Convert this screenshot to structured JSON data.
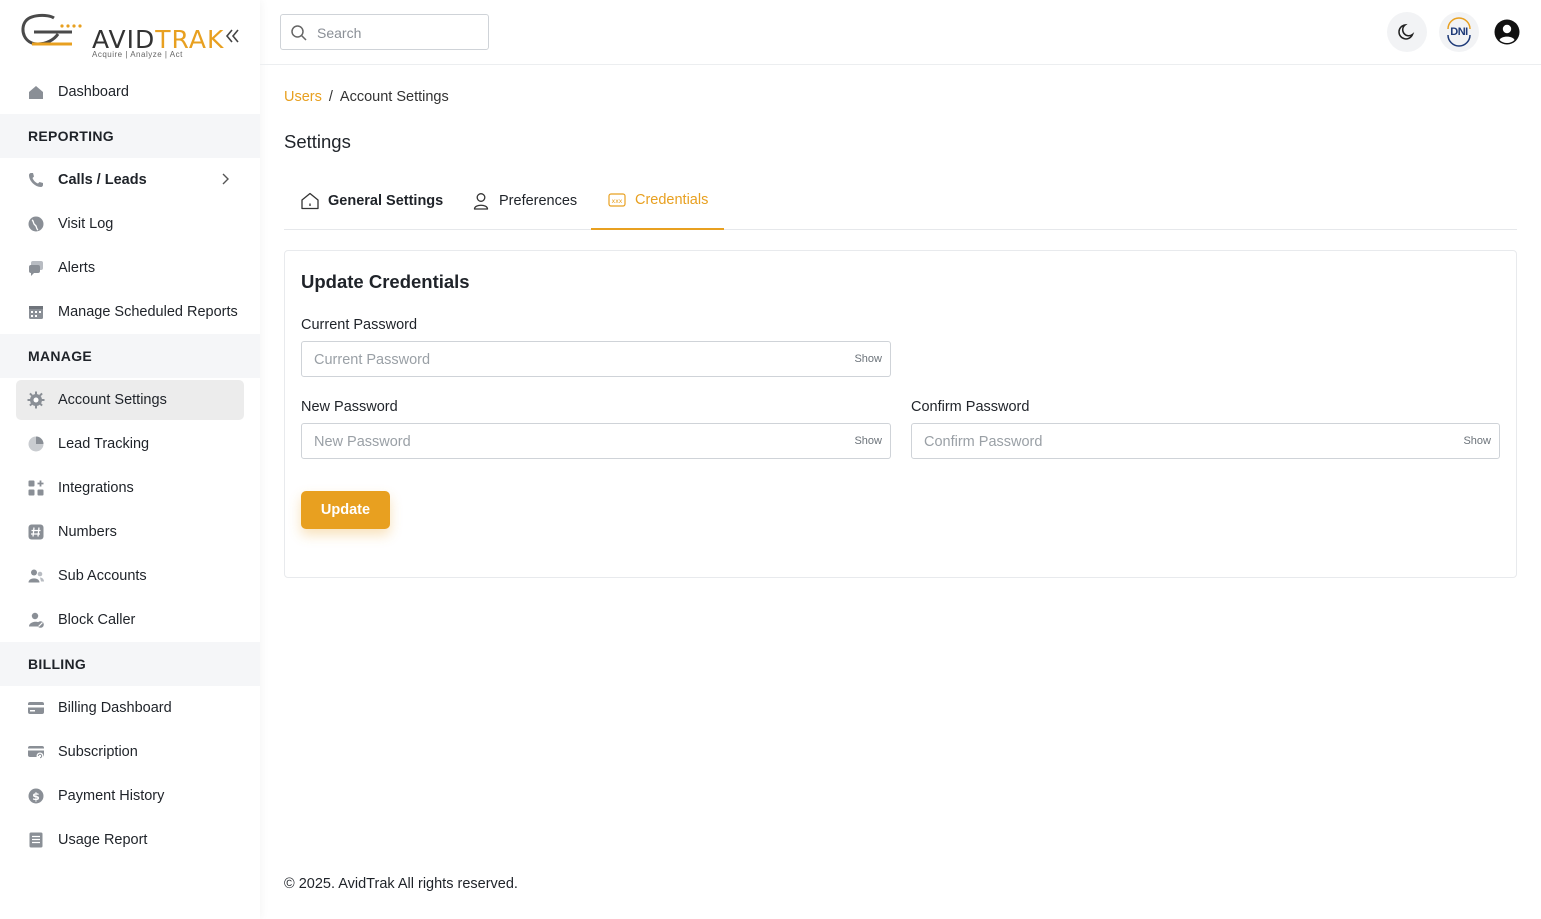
{
  "brand": {
    "name_part1": "AVID",
    "name_part2": "TRAK",
    "tagline": "Acquire  |  Analyze  |  Act",
    "accent_color": "#e8a020"
  },
  "sidebar": {
    "items": [
      {
        "type": "item",
        "label": "Dashboard",
        "icon": "home-icon"
      },
      {
        "type": "section",
        "label": "REPORTING"
      },
      {
        "type": "item",
        "label": "Calls / Leads",
        "icon": "phone-icon",
        "bold": true,
        "chevron": true
      },
      {
        "type": "item",
        "label": "Visit Log",
        "icon": "globe-icon"
      },
      {
        "type": "item",
        "label": "Alerts",
        "icon": "chat-bubbles-icon"
      },
      {
        "type": "item",
        "label": "Manage Scheduled Reports",
        "icon": "calendar-icon"
      },
      {
        "type": "section",
        "label": "MANAGE"
      },
      {
        "type": "item",
        "label": "Account Settings",
        "icon": "gear-icon",
        "active": true
      },
      {
        "type": "item",
        "label": "Lead Tracking",
        "icon": "pie-chart-icon"
      },
      {
        "type": "item",
        "label": "Integrations",
        "icon": "apps-plus-icon"
      },
      {
        "type": "item",
        "label": "Numbers",
        "icon": "hashtag-icon"
      },
      {
        "type": "item",
        "label": "Sub Accounts",
        "icon": "users-icon"
      },
      {
        "type": "item",
        "label": "Block Caller",
        "icon": "user-block-icon"
      },
      {
        "type": "section",
        "label": "BILLING"
      },
      {
        "type": "item",
        "label": "Billing Dashboard",
        "icon": "credit-card-icon"
      },
      {
        "type": "item",
        "label": "Subscription",
        "icon": "card-refresh-icon"
      },
      {
        "type": "item",
        "label": "Payment History",
        "icon": "dollar-circle-icon"
      },
      {
        "type": "item",
        "label": "Usage Report",
        "icon": "document-list-icon"
      }
    ]
  },
  "header": {
    "search_placeholder": "Search",
    "dni_label": "DNI",
    "theme_icon": "moon-icon",
    "profile_icon": "user-circle-icon"
  },
  "breadcrumb": {
    "parent": "Users",
    "separator": "/",
    "current": "Account Settings"
  },
  "page": {
    "title": "Settings"
  },
  "tabs": [
    {
      "label": "General Settings",
      "icon": "house-outline-icon"
    },
    {
      "label": "Preferences",
      "icon": "person-outline-icon"
    },
    {
      "label": "Credentials",
      "icon": "password-dots-icon",
      "active": true
    }
  ],
  "credentials": {
    "title": "Update Credentials",
    "current_password": {
      "label": "Current Password",
      "placeholder": "Current Password",
      "toggle": "Show"
    },
    "new_password": {
      "label": "New Password",
      "placeholder": "New Password",
      "toggle": "Show"
    },
    "confirm_password": {
      "label": "Confirm Password",
      "placeholder": "Confirm Password",
      "toggle": "Show"
    },
    "submit_label": "Update"
  },
  "footer": {
    "text": "© 2025. AvidTrak All rights reserved."
  }
}
